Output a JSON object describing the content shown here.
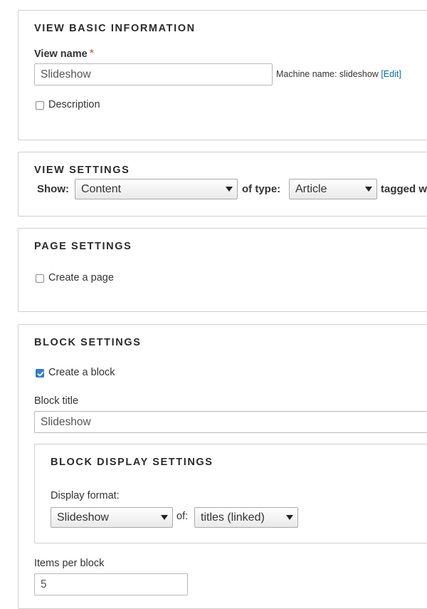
{
  "basic_info": {
    "legend": "View basic information",
    "view_name_label": "View name",
    "required_marker": "*",
    "view_name_value": "Slideshow",
    "machine_name_prefix": "Machine name: slideshow",
    "machine_name_edit": "Edit",
    "description_label": "Description",
    "description_checked": false
  },
  "view_settings": {
    "legend": "View settings",
    "show_label": "Show:",
    "show_value": "Content",
    "of_type_label": "of type:",
    "type_value": "Article",
    "tagged_label": "tagged w"
  },
  "page_settings": {
    "legend": "Page settings",
    "create_page_label": "Create a page",
    "create_page_checked": false
  },
  "block_settings": {
    "legend": "Block settings",
    "create_block_label": "Create a block",
    "create_block_checked": true,
    "block_title_label": "Block title",
    "block_title_value": "Slideshow",
    "display": {
      "legend": "Block display settings",
      "display_format_label": "Display format:",
      "display_format_value": "Slideshow",
      "of_label": "of:",
      "of_value": "titles (linked)"
    },
    "items_per_block_label": "Items per block",
    "items_per_block_value": "5"
  },
  "colors": {
    "required": "#e0452b",
    "link": "#0071b3",
    "checkbox_checked": "#2f7fd6"
  }
}
